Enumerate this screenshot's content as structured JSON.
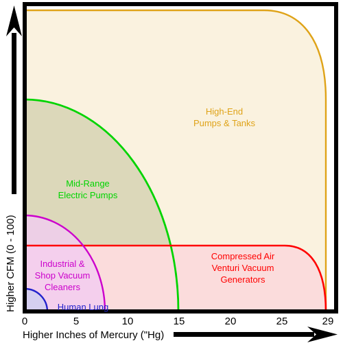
{
  "chart_data": {
    "type": "area",
    "title": "",
    "xlabel": "Higher Inches of Mercury (\"Hg)",
    "ylabel": "Higher CFM (0 - 100)",
    "xlim": [
      0,
      29
    ],
    "ylim": [
      0,
      100
    ],
    "xticks": [
      0,
      5,
      10,
      15,
      20,
      25,
      29
    ],
    "xtick_labels": [
      "0",
      "5",
      "10",
      "15",
      "20",
      "25",
      "29"
    ],
    "yticks": [],
    "ytick_labels": [],
    "grid": false,
    "legend_position": "in-plot-labels",
    "axis_arrows": [
      "x-right",
      "y-up"
    ],
    "series": [
      {
        "name": "High-End Pumps & Tanks",
        "label": "High-End\nPumps & Tanks",
        "label_line1": "High-End",
        "label_line2": "Pumps & Tanks",
        "color": "#DFA318",
        "fill": "#FAF2DF",
        "shape": "rounded-quadrant",
        "x_max": 29,
        "y_max": 97,
        "corner_radius_x": 7,
        "corner_radius_y": 60,
        "label_x": 21,
        "label_y": 72
      },
      {
        "name": "Mid-Range Electric Pumps",
        "label_line1": "Mid-Range",
        "label_line2": "Electric Pumps",
        "color": "#00D400",
        "fill": "#DFF5DF",
        "shape": "quarter-ellipse",
        "x_max": 15,
        "y_max": 69,
        "label_x": 4.9,
        "label_y": 44
      },
      {
        "name": "Compressed Air Venturi Vacuum Generators",
        "label_line1": "Compressed Air",
        "label_line2": "Venturi Vacuum",
        "label_line3": "Generators",
        "color": "#FF0000",
        "fill": "#FBDCDC",
        "shape": "rounded-quadrant",
        "x_max": 29,
        "y_max": 21,
        "corner_radius_x": 5.5,
        "corner_radius_y": 21,
        "label_x": 17.2,
        "label_y": 13
      },
      {
        "name": "Industrial & Shop Vacuum Cleaners",
        "label_line1": "Industrial &",
        "label_line2": "Shop Vacuum",
        "label_line3": "Cleaners",
        "color": "#CC00CC",
        "fill": "#F2CCF2",
        "shape": "quarter-ellipse",
        "x_max": 8,
        "y_max": 31,
        "label_x": 3.6,
        "label_y": 13
      },
      {
        "name": "Human Lung",
        "label_line1": "Human Lung",
        "color": "#2222CC",
        "fill": "#CFCFF0",
        "shape": "quarter-ellipse",
        "x_max": 2.2,
        "y_max": 7,
        "label_x": 6.5,
        "label_y": 2.6
      }
    ],
    "overlap_fill": "#DCD8BA",
    "plot_border_color": "#000000"
  },
  "axes": {
    "x_label": "Higher Inches of Mercury (\"Hg)",
    "y_label": "Higher CFM (0 - 100)",
    "x_ticks": [
      "0",
      "5",
      "10",
      "15",
      "20",
      "25",
      "29"
    ]
  },
  "labels": {
    "high_end_l1": "High-End",
    "high_end_l2": "Pumps & Tanks",
    "mid_range_l1": "Mid-Range",
    "mid_range_l2": "Electric Pumps",
    "compressed_l1": "Compressed Air",
    "compressed_l2": "Venturi Vacuum",
    "compressed_l3": "Generators",
    "industrial_l1": "Industrial &",
    "industrial_l2": "Shop Vacuum",
    "industrial_l3": "Cleaners",
    "human_lung": "Human Lung"
  },
  "colors": {
    "gold": "#DFA318",
    "green": "#00D400",
    "red": "#FF0000",
    "magenta": "#CC00CC",
    "blue": "#2222CC",
    "khaki": "#DCD8BA"
  }
}
